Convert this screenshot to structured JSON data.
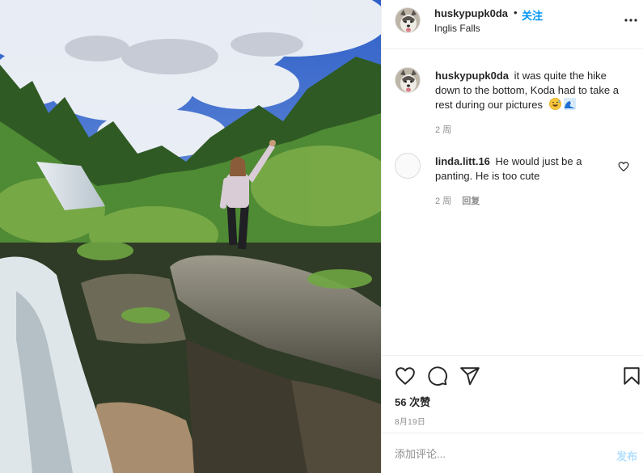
{
  "post": {
    "image_alt": "Woman standing on a rock with raised arm beside a waterfall at Inglis Falls",
    "author": "huskypupk0da",
    "follow_label": "关注",
    "location": "Inglis Falls",
    "caption": {
      "username": "huskypupk0da",
      "text": "it was quite the hike down to the bottom, Koda had to take a rest during our pictures",
      "emojis": [
        "grinning-sweat-emoji",
        "wave-emoji"
      ],
      "time": "2 周"
    },
    "comments": [
      {
        "username": "linda.litt.16",
        "text": "He would just be a panting. He is too cute",
        "time": "2 周",
        "reply_label": "回复"
      }
    ],
    "likes": "56 次赞",
    "date": "8月19日",
    "add_comment": {
      "placeholder": "添加评论...",
      "post_label": "发布"
    }
  },
  "icons": {
    "more": "more-horizontal-icon",
    "like": "heart-icon",
    "comment": "comment-icon",
    "share": "paper-plane-icon",
    "save": "bookmark-icon",
    "comment_like": "heart-small-icon"
  },
  "colors": {
    "link_blue": "#0095f6",
    "post_disabled": "#b2dffc",
    "secondary_text": "#8e8e8e",
    "divider": "#efefef"
  }
}
